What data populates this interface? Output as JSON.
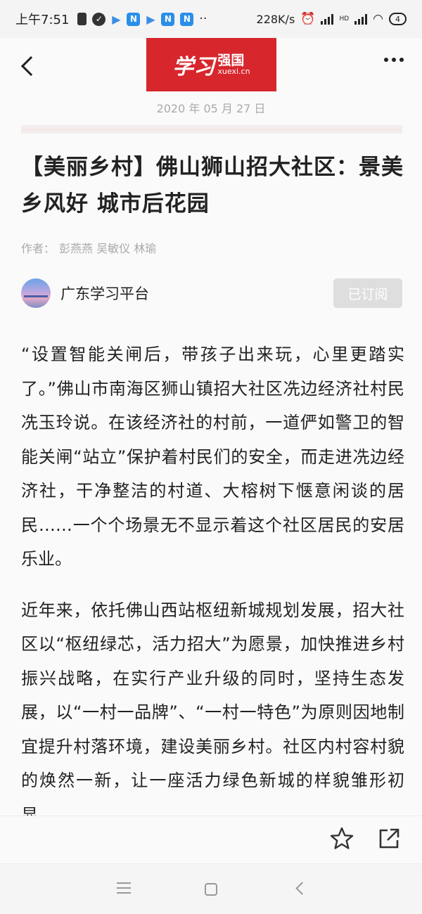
{
  "status_bar": {
    "time": "上午7:51",
    "app_icons": [
      "sim-icon",
      "check-icon",
      "play-icon",
      "n-app-icon",
      "play-icon",
      "n-app-icon",
      "n-app-icon"
    ],
    "more_indicator": "··",
    "network_speed": "228K/s",
    "hd_label": "HD",
    "battery": "4"
  },
  "header": {
    "logo_script": "学习",
    "logo_cn": "强国",
    "logo_en": "xuexi.cn",
    "date": "2020 年 05 月 27 日"
  },
  "article": {
    "title": "【美丽乡村】佛山狮山招大社区：景美乡风好 城市后花园",
    "authors_label": "作者：",
    "authors": "彭燕燕 吴敏仪 林瑜",
    "source_name": "广东学习平台",
    "subscribe_label": "已订阅",
    "paragraphs": [
      "“设置智能关闸后，带孩子出来玩，心里更踏实了。”佛山市南海区狮山镇招大社区冼边经济社村民冼玉玲说。在该经济社的村前，一道俨如警卫的智能关闸“站立”保护着村民们的安全，而走进冼边经济社，干净整洁的村道、大榕树下惬意闲谈的居民……一个个场景无不显示着这个社区居民的安居乐业。",
      "近年来，依托佛山西站枢纽新城规划发展，招大社区以“枢纽绿芯，活力招大”为愿景，加快推进乡村振兴战略，在实行产业升级的同时，坚持生态发展，以“一村一品牌”、“一村一特色”为原则因地制宜提升村落环境，建设美丽乡村。社区内村容村貌的焕然一新，让一座活力绿色新城的样貌雏形初显。"
    ]
  },
  "colors": {
    "logo_red": "#d7262c",
    "subscribe_bg": "#dedede",
    "muted_text": "#aaaaaa"
  }
}
